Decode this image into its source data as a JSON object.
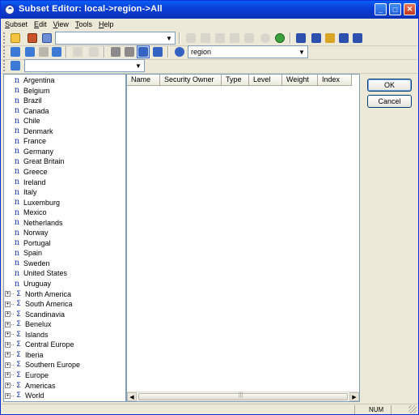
{
  "window": {
    "title": "Subset Editor:  local->region->All",
    "minimize": "_",
    "maximize": "□",
    "close": "✕"
  },
  "menu": [
    {
      "label": "Subset",
      "underline": "S",
      "rest": "ubset"
    },
    {
      "label": "Edit",
      "underline": "E",
      "rest": "dit"
    },
    {
      "label": "View",
      "underline": "V",
      "rest": "iew"
    },
    {
      "label": "Tools",
      "underline": "T",
      "rest": "ools"
    },
    {
      "label": "Help",
      "underline": "H",
      "rest": "elp"
    }
  ],
  "toolbar1": {
    "subset_combo_value": "",
    "sort_icons": [
      "sort-az-icon",
      "sort-za-icon",
      "sort-hierarchy-icon",
      "sort-asc-icon",
      "sort-desc-icon"
    ]
  },
  "toolbar2": {
    "dimension_combo_value": "region"
  },
  "toolbar3": {
    "filter_combo_value": ""
  },
  "tree": {
    "leaves": [
      "Argentina",
      "Belgium",
      "Brazil",
      "Canada",
      "Chile",
      "Denmark",
      "France",
      "Germany",
      "Great Britain",
      "Greece",
      "Ireland",
      "Italy",
      "Luxemburg",
      "Mexico",
      "Netherlands",
      "Norway",
      "Portugal",
      "Spain",
      "Sweden",
      "United States",
      "Uruguay"
    ],
    "consolidations": [
      "North America",
      "South America",
      "Scandinavia",
      "Benelux",
      "Islands",
      "Central Europe",
      "Iberia",
      "Southern Europe",
      "Europe",
      "Americas",
      "World"
    ],
    "leaf_glyph": "n",
    "consolidation_glyph": "Σ",
    "expand_glyph": "+"
  },
  "grid": {
    "columns": [
      "Name",
      "Security Owner",
      "Type",
      "Level",
      "Weight",
      "Index"
    ]
  },
  "buttons": {
    "ok": "OK",
    "cancel": "Cancel"
  },
  "status": {
    "num": "NUM"
  }
}
